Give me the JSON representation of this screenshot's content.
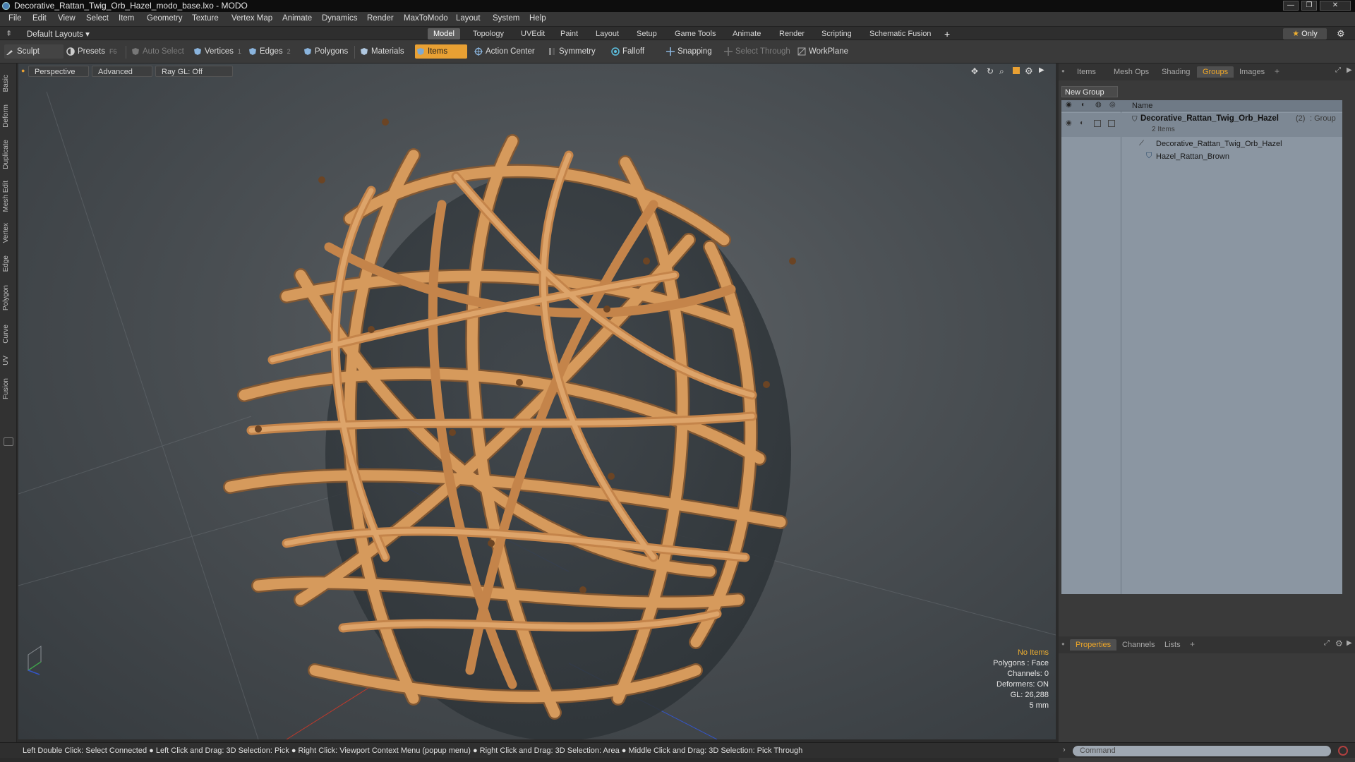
{
  "window": {
    "title": "Decorative_Rattan_Twig_Orb_Hazel_modo_base.lxo - MODO"
  },
  "menubar": {
    "items": [
      "File",
      "Edit",
      "View",
      "Select",
      "Item",
      "Geometry",
      "Texture",
      "Vertex Map",
      "Animate",
      "Dynamics",
      "Render",
      "MaxToModo",
      "Layout",
      "System",
      "Help"
    ]
  },
  "layoutbar": {
    "layout_dropdown": "Default Layouts",
    "tabs": [
      "Model",
      "Topology",
      "UVEdit",
      "Paint",
      "Layout",
      "Setup",
      "Game Tools",
      "Animate",
      "Render",
      "Scripting",
      "Schematic Fusion"
    ],
    "active_tab": "Model",
    "add_label": "+",
    "only_label": "Only"
  },
  "toolbar": {
    "sculpt": "Sculpt",
    "presets": "Presets",
    "presets_key": "F6",
    "auto_select": "Auto Select",
    "vertices": "Vertices",
    "vertices_count": "1",
    "edges": "Edges",
    "edges_count": "2",
    "polygons": "Polygons",
    "materials": "Materials",
    "items": "Items",
    "action_center": "Action Center",
    "symmetry": "Symmetry",
    "falloff": "Falloff",
    "snapping": "Snapping",
    "select_through": "Select Through",
    "workplane": "WorkPlane"
  },
  "left_tabs": [
    "Basic",
    "Deform",
    "Duplicate",
    "Mesh Edit",
    "Vertex",
    "Edge",
    "Polygon",
    "Curve",
    "UV",
    "Fusion"
  ],
  "viewport": {
    "view_mode": "Perspective",
    "shading": "Advanced",
    "raygl": "Ray GL: Off",
    "info": {
      "selection": "No Items",
      "polygons": "Polygons : Face",
      "channels": "Channels: 0",
      "deformers": "Deformers: ON",
      "gl": "GL: 26,288",
      "scale": "5 mm"
    }
  },
  "right_panel": {
    "tabs": [
      "Items",
      "Mesh Ops",
      "Shading",
      "Groups",
      "Images"
    ],
    "active_tab": "Groups",
    "new_group": "New Group",
    "column_name": "Name",
    "group": {
      "name": "Decorative_Rattan_Twig_Orb_Hazel",
      "count": "(2)",
      "type": ": Group",
      "sub": "2 Items"
    },
    "children": [
      "Decorative_Rattan_Twig_Orb_Hazel",
      "Hazel_Rattan_Brown"
    ],
    "bottom_tabs": [
      "Properties",
      "Channels",
      "Lists"
    ],
    "bottom_active": "Properties"
  },
  "statusbar": {
    "text": "Left Double Click: Select Connected ● Left Click and Drag: 3D Selection: Pick ● Right Click: Viewport Context Menu (popup menu) ● Right Click and Drag: 3D Selection: Area ● Middle Click and Drag: 3D Selection: Pick Through"
  },
  "command": {
    "placeholder": "Command"
  },
  "colors": {
    "accent": "#e8a033",
    "group_list_bg": "#8b96a2",
    "rattan": "#c98a4e"
  }
}
